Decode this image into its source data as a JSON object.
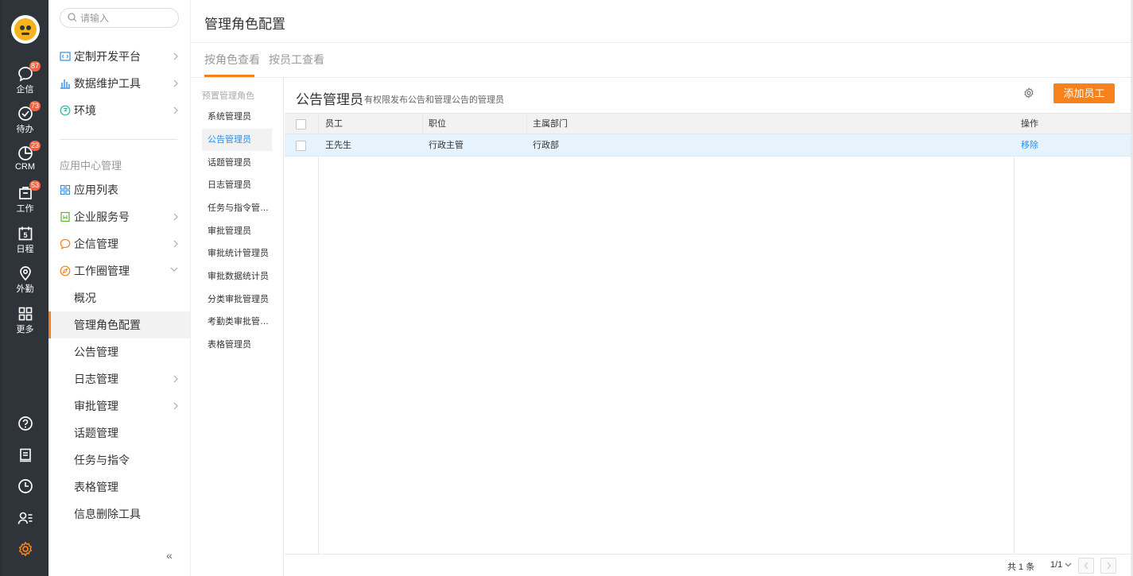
{
  "rail": {
    "items": [
      {
        "label": "企信",
        "badge": "87"
      },
      {
        "label": "待办",
        "badge": "73"
      },
      {
        "label": "CRM",
        "badge": "23"
      },
      {
        "label": "工作",
        "badge": "53"
      },
      {
        "label": "日程",
        "calendar_day": "5"
      },
      {
        "label": "外勤"
      },
      {
        "label": "更多"
      }
    ],
    "accent": "#f7821b"
  },
  "nav": {
    "search_placeholder": "请输入",
    "top_items": [
      {
        "label": "定制开发平台"
      },
      {
        "label": "数据维护工具"
      },
      {
        "label": "环境"
      }
    ],
    "section_title": "应用中心管理",
    "app_items": [
      {
        "label": "应用列表"
      },
      {
        "label": "企业服务号"
      },
      {
        "label": "企信管理"
      },
      {
        "label": "工作圈管理"
      }
    ],
    "sub_items": [
      {
        "label": "概况"
      },
      {
        "label": "管理角色配置"
      },
      {
        "label": "公告管理"
      },
      {
        "label": "日志管理"
      },
      {
        "label": "审批管理"
      },
      {
        "label": "话题管理"
      },
      {
        "label": "任务与指令"
      },
      {
        "label": "表格管理"
      },
      {
        "label": "信息删除工具"
      }
    ],
    "collapse_label": "«"
  },
  "page": {
    "title": "管理角色配置",
    "tabs": [
      "按角色查看",
      "按员工查看"
    ]
  },
  "roles": {
    "section_title": "预置管理角色",
    "items": [
      "系统管理员",
      "公告管理员",
      "话题管理员",
      "日志管理员",
      "任务与指令管理员",
      "审批管理员",
      "审批统计管理员",
      "审批数据统计员",
      "分类审批管理员",
      "考勤类审批管理员",
      "表格管理员"
    ],
    "active": "公告管理员"
  },
  "detail": {
    "title": "公告管理员",
    "description": "有权限发布公告和管理公告的管理员",
    "add_button": "添加员工",
    "columns": [
      "员工",
      "职位",
      "主属部门",
      "操作"
    ],
    "rows": [
      {
        "employee": "王先生",
        "position": "行政主管",
        "department": "行政部",
        "action": "移除"
      }
    ],
    "pager": {
      "total": "共 1 条",
      "page": "1/1"
    }
  }
}
